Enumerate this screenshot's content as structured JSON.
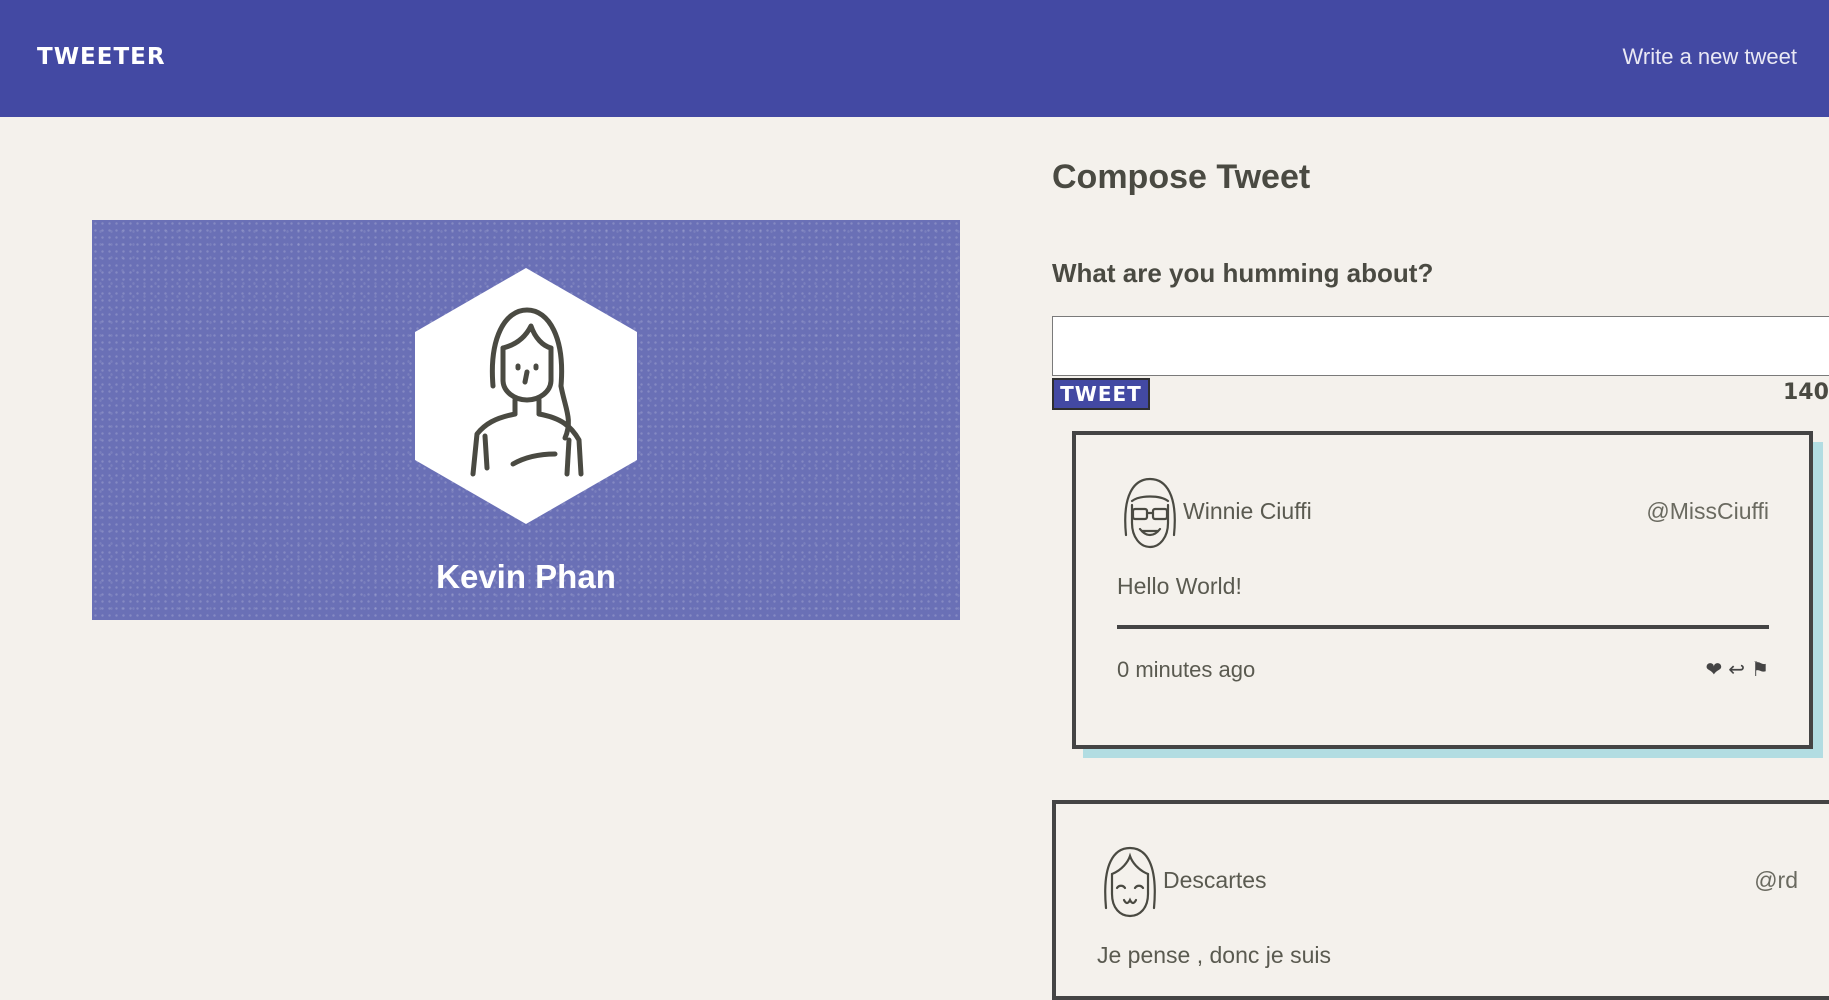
{
  "header": {
    "brand": "TWEETER",
    "compose_link": "Write a new tweet",
    "background_color": "#4349a3"
  },
  "profile": {
    "name": "Kevin Phan",
    "avatar_icon": "girl-avatar-icon",
    "card_color": "#6a70b6"
  },
  "compose": {
    "title": "Compose Tweet",
    "label": "What are you humming about?",
    "input_value": "",
    "button_label": "TWEET",
    "counter": "140"
  },
  "tweets": [
    {
      "author": "Winnie Ciuffi",
      "handle": "@MissCiuffi",
      "content": "Hello World!",
      "time": "0 minutes ago",
      "avatar_icon": "sunglasses-avatar-icon",
      "actions": [
        {
          "name": "like-icon",
          "glyph": "❤"
        },
        {
          "name": "retweet-icon",
          "glyph": "↩"
        },
        {
          "name": "flag-icon",
          "glyph": "⚑"
        }
      ]
    },
    {
      "author": "Descartes",
      "handle": "@rd",
      "content": "Je pense , donc je suis",
      "avatar_icon": "smiling-avatar-icon"
    }
  ],
  "colors": {
    "page_background": "#f4f1ec",
    "text": "#4a4a42",
    "tweet_shadow": "#b2dde2",
    "tweet_border": "#444444"
  }
}
